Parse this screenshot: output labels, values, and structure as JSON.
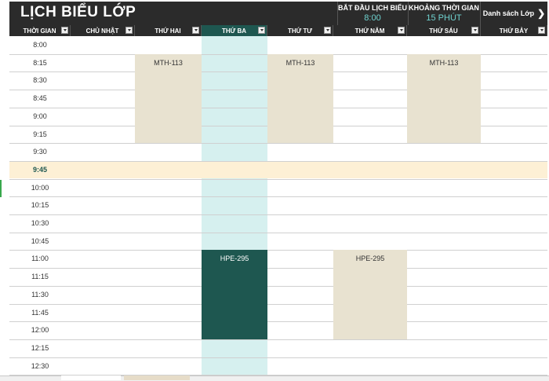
{
  "header": {
    "title": "LỊCH BIỂU LỚP",
    "start_label": "BẮT ĐẦU LỊCH BIỂU",
    "start_value": "8:00",
    "interval_label": "KHOẢNG THỜI GIAN",
    "interval_value": "15 PHÚT",
    "nav_link": "Danh sách Lớp",
    "nav_icon": "chevron-right-icon"
  },
  "columns": [
    "THỜI GIAN",
    "CHỦ NHẬT",
    "THỨ HAI",
    "THỨ BA",
    "THỨ TƯ",
    "THỨ NĂM",
    "THỨ SÁU",
    "THỨ BẢY"
  ],
  "times": [
    "8:00",
    "8:15",
    "8:30",
    "8:45",
    "9:00",
    "9:15",
    "9:30",
    "9:45",
    "10:00",
    "10:15",
    "10:30",
    "10:45",
    "11:00",
    "11:15",
    "11:30",
    "11:45",
    "12:00",
    "12:15",
    "12:30"
  ],
  "highlighted_time": "9:45",
  "classes": [
    {
      "label": "MTH-113",
      "day": "THỨ HAI",
      "start": "8:15",
      "end": "9:30"
    },
    {
      "label": "MTH-113",
      "day": "THỨ TƯ",
      "start": "8:15",
      "end": "9:30"
    },
    {
      "label": "MTH-113",
      "day": "THỨ SÁU",
      "start": "8:15",
      "end": "9:30"
    },
    {
      "label": "HPE-295",
      "day": "THỨ BA",
      "start": "11:00",
      "end": "12:15"
    },
    {
      "label": "HPE-295",
      "day": "THỨ NĂM",
      "start": "11:00",
      "end": "12:15"
    }
  ],
  "colors": {
    "header_bg": "#2b2b2b",
    "accent_dark": "#1e5750",
    "accent_light": "#d6f0ef",
    "block_beige": "#e8e2d0",
    "highlight_row": "#fdf0d5",
    "value_teal": "#6fd3d0"
  }
}
